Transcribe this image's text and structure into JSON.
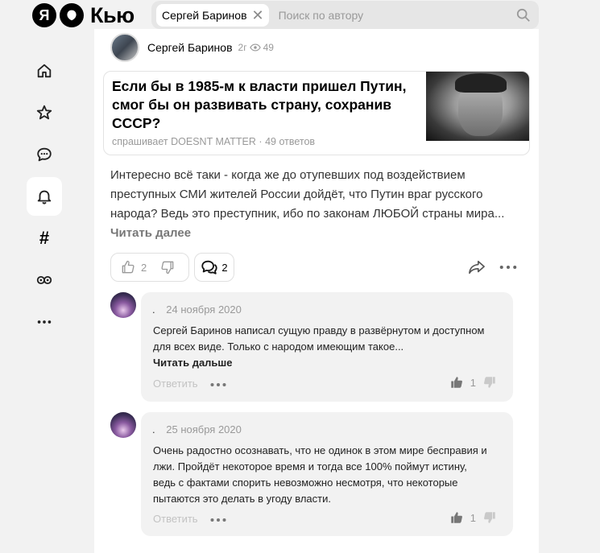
{
  "header": {
    "logo_letter": "Я",
    "logo_text": "Кью",
    "search_chip": "Сергей Баринов",
    "search_placeholder": "Поиск по автору"
  },
  "author": {
    "name": "Сергей Баринов",
    "age": "2г",
    "views": "49"
  },
  "question": {
    "title": "Если бы в 1985-м к власти пришел Путин, смог бы он развивать страну, сохранив СССР?",
    "asked_by": "спрашивает DOESNT MATTER",
    "separator": "·",
    "answers": "49 ответов"
  },
  "answer": {
    "text": "Интересно всё таки - когда же до отупевших под воздействием преступных СМИ жителей России дойдёт, что Путин враг русского народа? Ведь это преступник, ибо по законам ЛЮБОЙ страны мира...",
    "read_more": "Читать далее"
  },
  "actions": {
    "likes": "2",
    "comments": "2"
  },
  "comments": [
    {
      "author": ".",
      "date": "24 ноября 2020",
      "text": "Сергей Баринов написал сущую правду в развёрнутом и доступном для всех виде. Только с народом имеющим такое...",
      "read_more": "Читать дальше",
      "reply": "Ответить",
      "likes": "1"
    },
    {
      "author": ".",
      "date": "25 ноября 2020",
      "text": "Очень радостно осознавать, что не одинок в этом мире бесправия и лжи. Пройдёт некоторое время и тогда все 100% поймут истину, ведь с фактами спорить невозможно несмотря, что некоторые пытаются это делать в угоду власти.",
      "reply": "Ответить",
      "likes": "1"
    }
  ]
}
